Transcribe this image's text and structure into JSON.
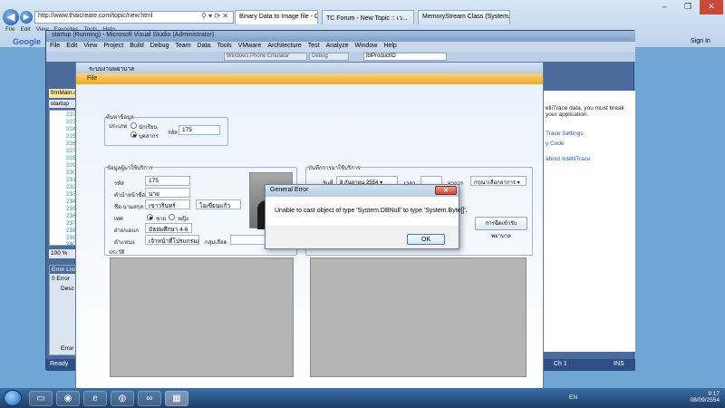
{
  "ie": {
    "address": "http://www.thaicreate.com/topic/new.html",
    "tabs": [
      "Binary Data to Image file - C#",
      "TC Forum - New Topic :: เว...",
      "MemoryStream Class (System.I..."
    ],
    "menu": [
      "File",
      "Edit",
      "View",
      "Favorites",
      "Tools",
      "Help"
    ],
    "google": "Google",
    "signin": "Sign In",
    "window_controls": [
      "–",
      "❐",
      "✕"
    ]
  },
  "vs": {
    "title": "startup (Running) - Microsoft Visual Studio (Administrator)",
    "menu": [
      "File",
      "Edit",
      "View",
      "Project",
      "Build",
      "Debug",
      "Team",
      "Data",
      "Tools",
      "VMware",
      "Architecture",
      "Test",
      "Analyze",
      "Window",
      "Help"
    ],
    "toolbar": {
      "emulator": "Windows Phone Emulator",
      "config": "Debug",
      "member": "lblProductID"
    },
    "doc_tab": "frmMain.cs",
    "solution_tab": "startup",
    "line_numbers": [
      "222",
      "223",
      "224",
      "225",
      "226",
      "227",
      "228",
      "229",
      "230",
      "231",
      "232",
      "233",
      "234",
      "235",
      "236",
      "237",
      "238",
      "239",
      "240"
    ],
    "zoom": "100 %",
    "error_list": {
      "title": "Error List",
      "count": "0 Error",
      "col": "Desc",
      "tab": "Error Li"
    },
    "intellitrace": {
      "line1": "elliTrace data, you must break",
      "line2": "your application.",
      "link1": "Trace Settings",
      "link2": "y Code",
      "link3": "about IntelliTrace"
    },
    "status": {
      "left": "Ready",
      "mid": "Ch 1",
      "right": "INS"
    }
  },
  "app": {
    "title": "ระบบงานพยาบาล",
    "menu": "File",
    "search_group": {
      "title": "ค้นหาข้อมูล",
      "type_label": "ประเภท",
      "radio1": "นักเรียน",
      "radio2": "บุคลากร",
      "id_label": "รหัส",
      "id_value": "175"
    },
    "user_group": {
      "title": "ข้อมูลผู้มาใช้บริการ",
      "id_label": "รหัส",
      "id_value": "175",
      "prefix_label": "คำนำหน้าชื่อ",
      "prefix_value": "นาย",
      "name_label": "ชื่อ-นามสกุล",
      "firstname": "เขาวรินทร์",
      "lastname": "โอเขียนแก้ว",
      "sex_label": "เพศ",
      "male": "ชาย",
      "female": "หญิง",
      "dept_label": "ฝ่าย/แผนก",
      "dept_value": "มัธยมศึกษา 4-6",
      "position_label": "ตำแหน่ง",
      "position_value": "เจ้าหน้าที่โปรแกรมเมอร์",
      "blood_label": "กลุ่มเลือด",
      "history_label": "ประวัติ"
    },
    "record_group": {
      "title": "บันทึกการมาใช้บริการ",
      "date_label": "วันที่",
      "day": "8",
      "month": "กันยายน",
      "year": "2554",
      "time_label": "เวลา",
      "symptom_label": "อาการ",
      "symptom_value": "กรุณาเลือกอาการ",
      "save_button": "การฉีดเข้ารับพยาบาล"
    }
  },
  "dialog": {
    "title": "General Error",
    "close": "✕",
    "message": "Unable to cast object of type 'System.DBNull' to type 'System.Byte[]'.",
    "ok": "OK"
  },
  "taskbar": {
    "lang": "EN",
    "time": "9:17",
    "date": "08/09/2554"
  }
}
